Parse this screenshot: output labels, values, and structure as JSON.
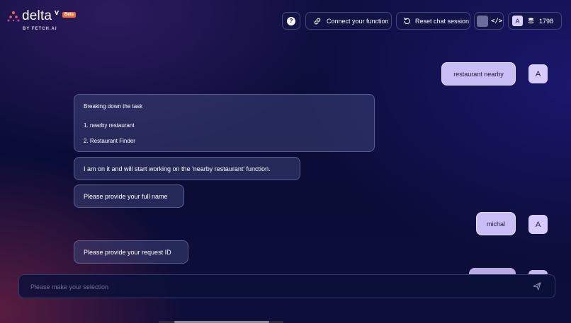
{
  "brand": {
    "name": "delta",
    "mark": "v",
    "badge": "Beta",
    "byline": "BY FETCH.AI"
  },
  "header": {
    "help_label": "?",
    "connect_label": "Connect your function",
    "reset_label": "Reset chat session",
    "code_label": "</>",
    "account_initial": "A",
    "credits": "1798"
  },
  "chat": {
    "user_messages": [
      {
        "text": "restaurant nearby",
        "avatar": "A"
      },
      {
        "text": "michal",
        "avatar": "A"
      }
    ],
    "task_breakdown": {
      "title": "Breaking down the task",
      "items": [
        "1. nearby restaurant",
        "2. Restaurant Finder"
      ]
    },
    "bot_messages": [
      "I am on it and will start working on the 'nearby restaurant' function.",
      "Please provide your full name",
      "Please provide your request ID"
    ]
  },
  "input": {
    "placeholder": "Please make your selection",
    "value": ""
  },
  "colors": {
    "user_bubble": "#c9bdf5",
    "beta_badge": "#f26a3a",
    "background": "#0d0f3e"
  }
}
